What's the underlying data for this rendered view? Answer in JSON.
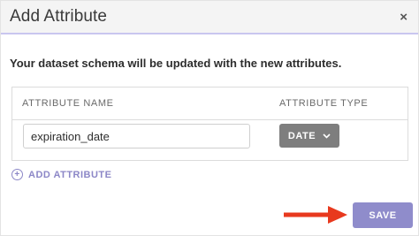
{
  "dialog": {
    "title": "Add Attribute",
    "close_glyph": "×",
    "description": "Your dataset schema will be updated with the new attributes."
  },
  "table": {
    "headers": {
      "name": "ATTRIBUTE NAME",
      "type": "ATTRIBUTE TYPE"
    },
    "rows": [
      {
        "name_value": "expiration_date",
        "type_value": "DATE",
        "type_icon": "chevron-down-icon"
      }
    ]
  },
  "actions": {
    "add_label": "ADD ATTRIBUTE",
    "add_icon": "plus-circle-icon",
    "save_label": "SAVE"
  },
  "annotation": {
    "arrow_color": "#e8391e",
    "arrow_icon": "arrow-right-icon"
  },
  "colors": {
    "accent": "#8f8ccb",
    "header_border": "#c9c6ef",
    "select_bg": "#7e7e7e"
  }
}
